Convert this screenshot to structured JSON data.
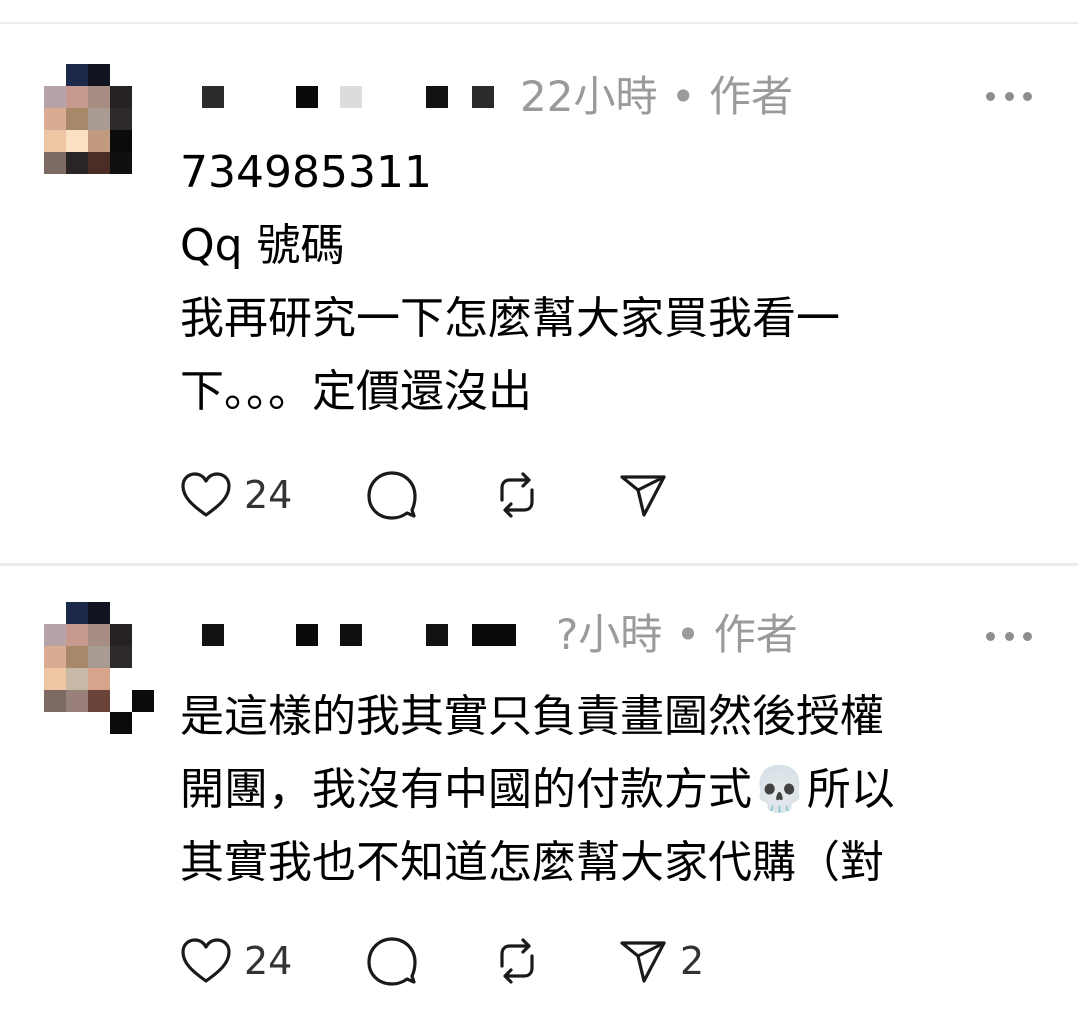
{
  "posts": [
    {
      "time": "22小時",
      "separator": "•",
      "author_tag": "作者",
      "lines": [
        "734985311",
        "Qq 號碼",
        "我再研究一下怎麼幫大家買我看一",
        "下。。。定價還沒出"
      ],
      "likes": "24",
      "shares": ""
    },
    {
      "time": "?小時",
      "separator": "•",
      "author_tag": "作者",
      "lines": [
        "是這樣的我其實只負責畫圖然後授權",
        "開團，我沒有中國的付款方式💀所以",
        "其實我也不知道怎麼幫大家代購（對"
      ],
      "likes": "24",
      "shares": "2"
    }
  ],
  "icons": {
    "like": "heart-icon",
    "reply": "comment-bubble-icon",
    "repost": "repost-icon",
    "share": "send-icon",
    "more": "more-horizontal-icon"
  },
  "colors": {
    "meta_text": "#9a9a9a",
    "divider": "#ececec",
    "icon": "#1a1a1a"
  }
}
